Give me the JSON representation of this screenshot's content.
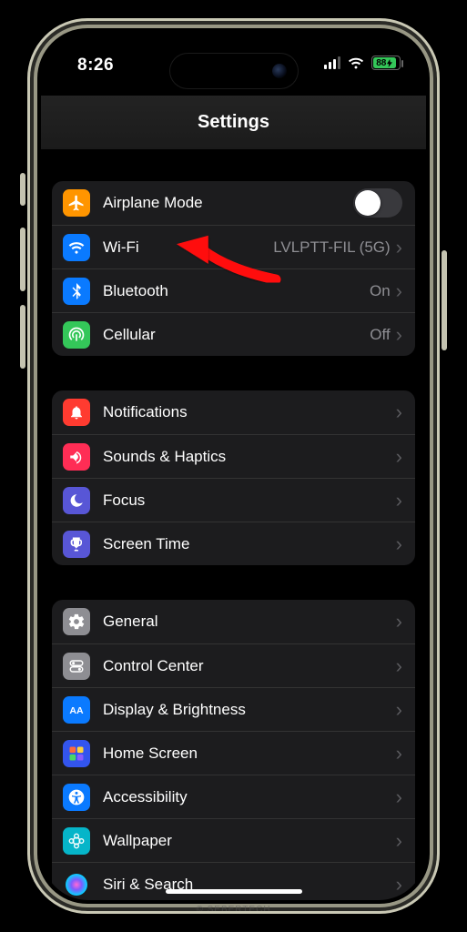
{
  "statusbar": {
    "time": "8:26",
    "battery_percent": "88"
  },
  "page": {
    "title": "Settings"
  },
  "groups": [
    {
      "rows": [
        {
          "icon": "airplane-icon",
          "icon_bg": "#ff9500",
          "label": "Airplane Mode",
          "accessory": "switch",
          "switch_on": false
        },
        {
          "icon": "wifi-icon",
          "icon_bg": "#0a7aff",
          "label": "Wi-Fi",
          "value": "LVLPTT-FIL (5G)",
          "accessory": "chevron"
        },
        {
          "icon": "bluetooth-icon",
          "icon_bg": "#0a7aff",
          "label": "Bluetooth",
          "value": "On",
          "accessory": "chevron"
        },
        {
          "icon": "cellular-icon",
          "icon_bg": "#34c759",
          "label": "Cellular",
          "value": "Off",
          "accessory": "chevron"
        }
      ]
    },
    {
      "rows": [
        {
          "icon": "notifications-icon",
          "icon_bg": "#ff3b30",
          "label": "Notifications",
          "accessory": "chevron"
        },
        {
          "icon": "sounds-icon",
          "icon_bg": "#ff2d55",
          "label": "Sounds & Haptics",
          "accessory": "chevron"
        },
        {
          "icon": "focus-icon",
          "icon_bg": "#5856d6",
          "label": "Focus",
          "accessory": "chevron"
        },
        {
          "icon": "screen-time-icon",
          "icon_bg": "#5856d6",
          "label": "Screen Time",
          "accessory": "chevron"
        }
      ]
    },
    {
      "rows": [
        {
          "icon": "gear-icon",
          "icon_bg": "#8e8e93",
          "label": "General",
          "accessory": "chevron"
        },
        {
          "icon": "control-center-icon",
          "icon_bg": "#8e8e93",
          "label": "Control Center",
          "accessory": "chevron"
        },
        {
          "icon": "display-icon",
          "icon_bg": "#0a7aff",
          "label": "Display & Brightness",
          "accessory": "chevron"
        },
        {
          "icon": "home-screen-icon",
          "icon_bg": "#3355ee",
          "label": "Home Screen",
          "accessory": "chevron"
        },
        {
          "icon": "accessibility-icon",
          "icon_bg": "#0a7aff",
          "label": "Accessibility",
          "accessory": "chevron"
        },
        {
          "icon": "wallpaper-icon",
          "icon_bg": "#06b5c9",
          "label": "Wallpaper",
          "accessory": "chevron"
        },
        {
          "icon": "siri-icon",
          "icon_bg": "#1c1c1e",
          "label": "Siri & Search",
          "accessory": "chevron"
        }
      ]
    }
  ],
  "watermark": "© SEBERTECH"
}
